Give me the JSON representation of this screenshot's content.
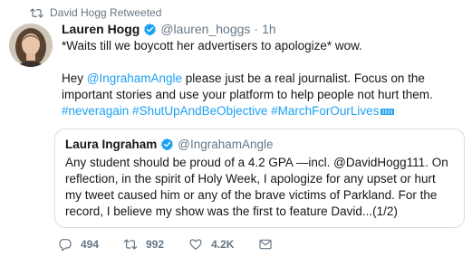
{
  "retweet": {
    "label": "David Hogg Retweeted"
  },
  "tweet": {
    "name": "Lauren Hogg",
    "handle": "@lauren_hoggs",
    "separator": "·",
    "time": "1h",
    "line1": "*Waits till we boycott her advertisers to apologize* wow.",
    "line2_start": "Hey ",
    "line2_mention": "@IngrahamAngle",
    "line2_rest": " please just be a real journalist. Focus on the important stories and use your platform to help people not hurt them.",
    "hashtags": "#neveragain #ShutUpAndBeObjective #MarchForOurLives"
  },
  "quote": {
    "name": "Laura Ingraham",
    "handle": "@IngrahamAngle",
    "text": "Any student should be proud of a 4.2 GPA —incl. @DavidHogg111.  On reflection, in the spirit of Holy Week, I apologize for any upset or hurt my tweet caused him or any of the brave victims of Parkland. For the record, I believe my show was the first to feature David...(1/2)"
  },
  "actions": {
    "replies": "494",
    "retweets": "992",
    "likes": "4.2K"
  },
  "colors": {
    "link": "#1da1f2",
    "muted": "#657786",
    "verified": "#1da1f2"
  },
  "icons": [
    "retweet-icon",
    "verified-badge-icon",
    "reply-icon",
    "like-icon",
    "message-icon"
  ]
}
